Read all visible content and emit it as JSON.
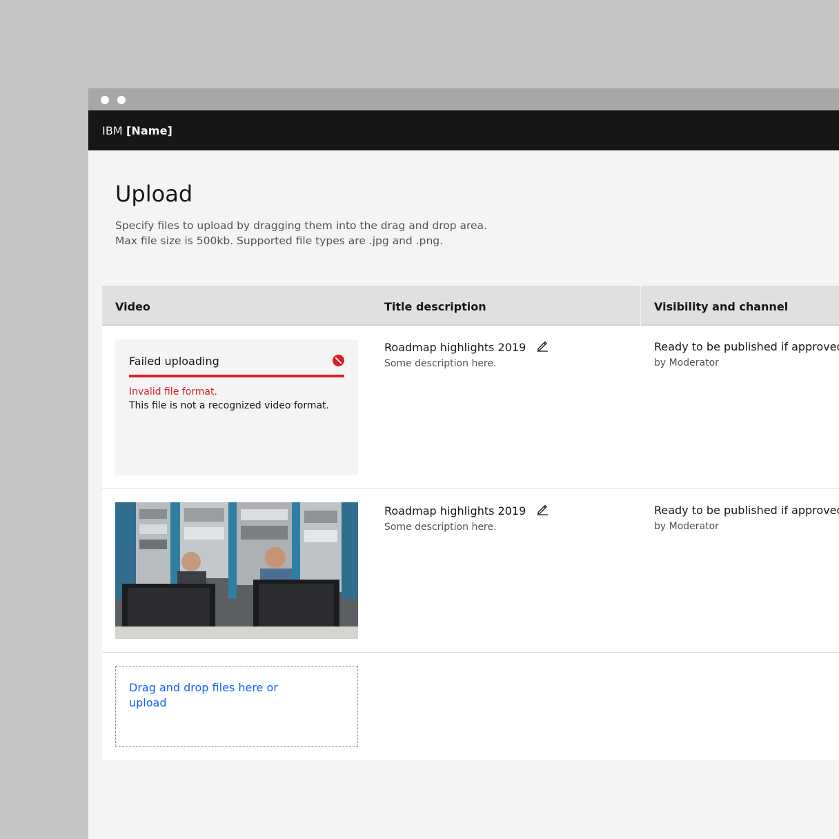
{
  "app": {
    "brand_company": "IBM",
    "brand_product": "[Name]"
  },
  "page": {
    "title": "Upload",
    "helper_line1": "Specify files to upload by dragging them into the drag and drop area.",
    "helper_line2": "Max file size is 500kb. Supported file types are .jpg and .png."
  },
  "table": {
    "headers": [
      "Video",
      "Title description",
      "Visibility and channel"
    ],
    "rows": [
      {
        "video": {
          "state": "failed",
          "status": "Failed uploading",
          "error": "Invalid file format.",
          "message": "This file is not a recognized video format."
        },
        "title": "Roadmap highlights 2019",
        "description": "Some description here.",
        "visibility": "Ready to be published if approved",
        "visibility_by": "by Moderator"
      },
      {
        "video": {
          "state": "thumbnail",
          "icon": "video-thumbnail-image"
        },
        "title": "Roadmap highlights 2019",
        "description": "Some description here.",
        "visibility": "Ready to be published if approved",
        "visibility_by": "by Moderator"
      }
    ],
    "dropzone_text": "Drag and drop files here or upload"
  },
  "colors": {
    "error": "#da1e28",
    "link": "#0f62fe",
    "header_bg": "#161616",
    "table_header_bg": "#e0e0e0"
  },
  "icons": {
    "error": "error-filled-icon",
    "edit": "pencil-icon"
  }
}
